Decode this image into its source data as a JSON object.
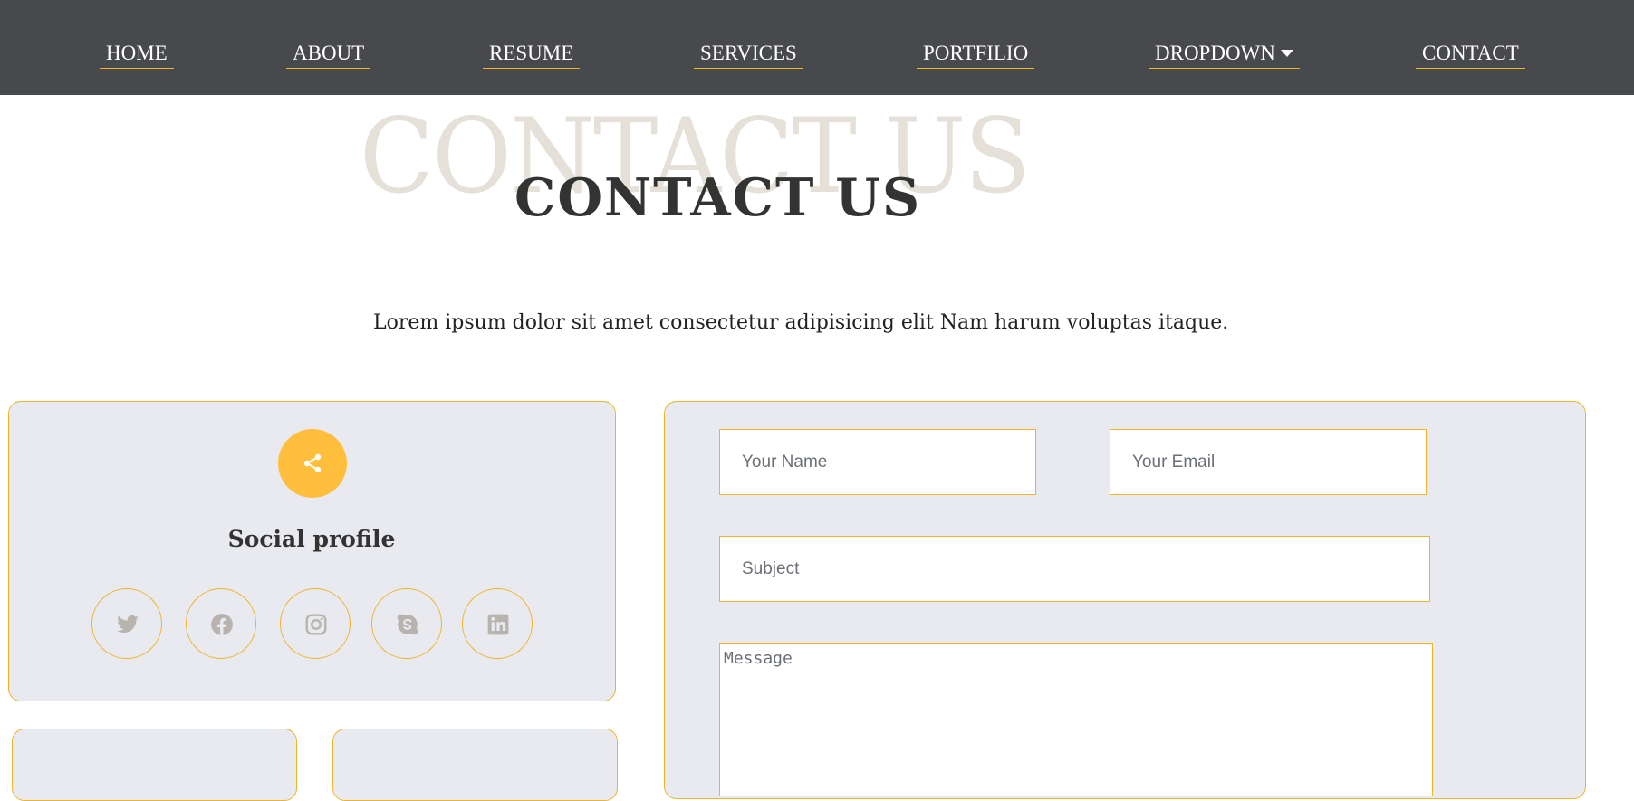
{
  "nav": {
    "items": [
      {
        "label": "HOME"
      },
      {
        "label": "ABOUT"
      },
      {
        "label": "RESUME"
      },
      {
        "label": "SERVICES"
      },
      {
        "label": "PORTFILIO"
      },
      {
        "label": "DROPDOWN"
      },
      {
        "label": "CONTACT"
      }
    ]
  },
  "hero": {
    "bg_title": "CONTACT US",
    "title": "CONTACT US",
    "subtitle": "Lorem ipsum dolor sit amet consectetur adipisicing elit Nam harum voluptas itaque."
  },
  "social": {
    "title": "Social profile",
    "icons": [
      "twitter-icon",
      "facebook-icon",
      "instagram-icon",
      "skype-icon",
      "linkedin-icon"
    ]
  },
  "form": {
    "name_placeholder": "Your Name",
    "email_placeholder": "Your Email",
    "subject_placeholder": "Subject",
    "message_placeholder": "Message"
  },
  "colors": {
    "navbar": "#48494d",
    "accent": "#f0b429",
    "share_circle": "#ffbe3b",
    "card_bg": "#e8eaef",
    "bg_title": "#e5e1d8",
    "icon_gray": "#b9b3ae"
  }
}
